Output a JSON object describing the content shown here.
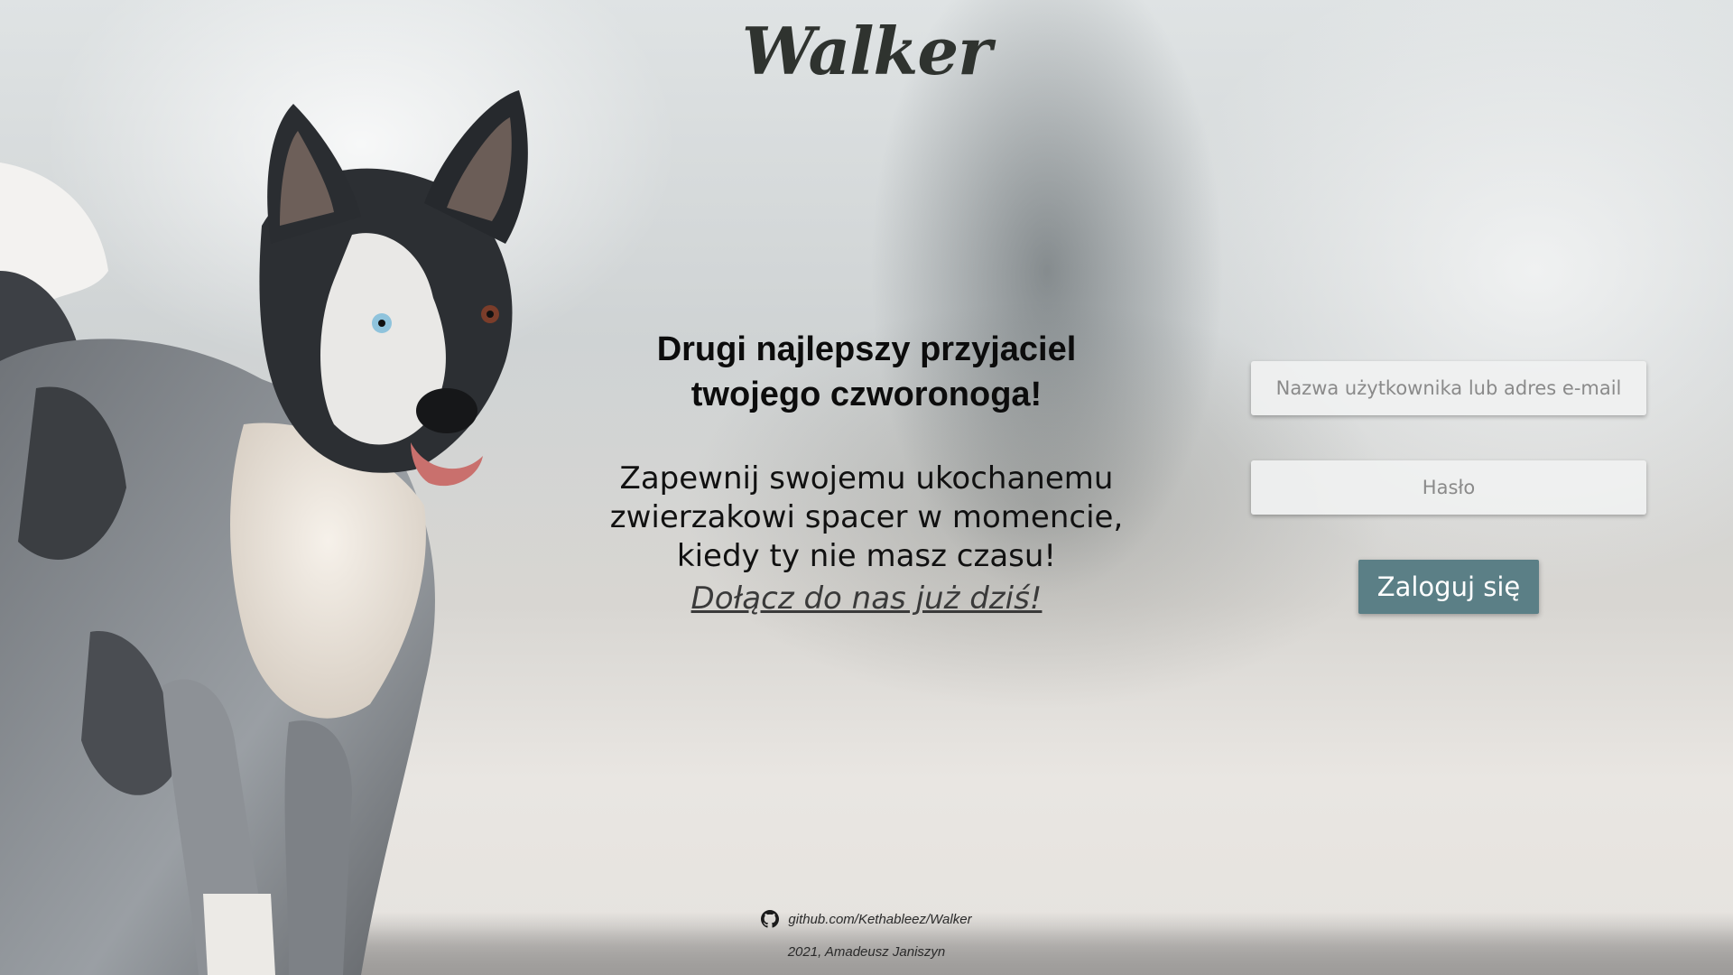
{
  "brand": {
    "logo_text": "Walker"
  },
  "hero": {
    "title_line1": "Drugi najlepszy przyjaciel",
    "title_line2": "twojego czworonoga!",
    "body_line1": "Zapewnij swojemu ukochanemu",
    "body_line2": "zwierzakowi spacer w momencie,",
    "body_line3": "kiedy ty nie masz czasu!",
    "cta_link": "Dołącz do nas już dziś!"
  },
  "login": {
    "username_placeholder": "Nazwa użytkownika lub adres e-mail",
    "username_value": "",
    "password_placeholder": "Hasło",
    "password_value": "",
    "submit_label": "Zaloguj się"
  },
  "footer": {
    "github_link": "github.com/Kethableez/Walker",
    "credit": "2021, Amadeusz Janiszyn"
  },
  "icons": {
    "github": "github-icon"
  },
  "colors": {
    "button_bg": "#5b7f86",
    "button_text": "#ffffff",
    "logo": "#2f332f"
  }
}
